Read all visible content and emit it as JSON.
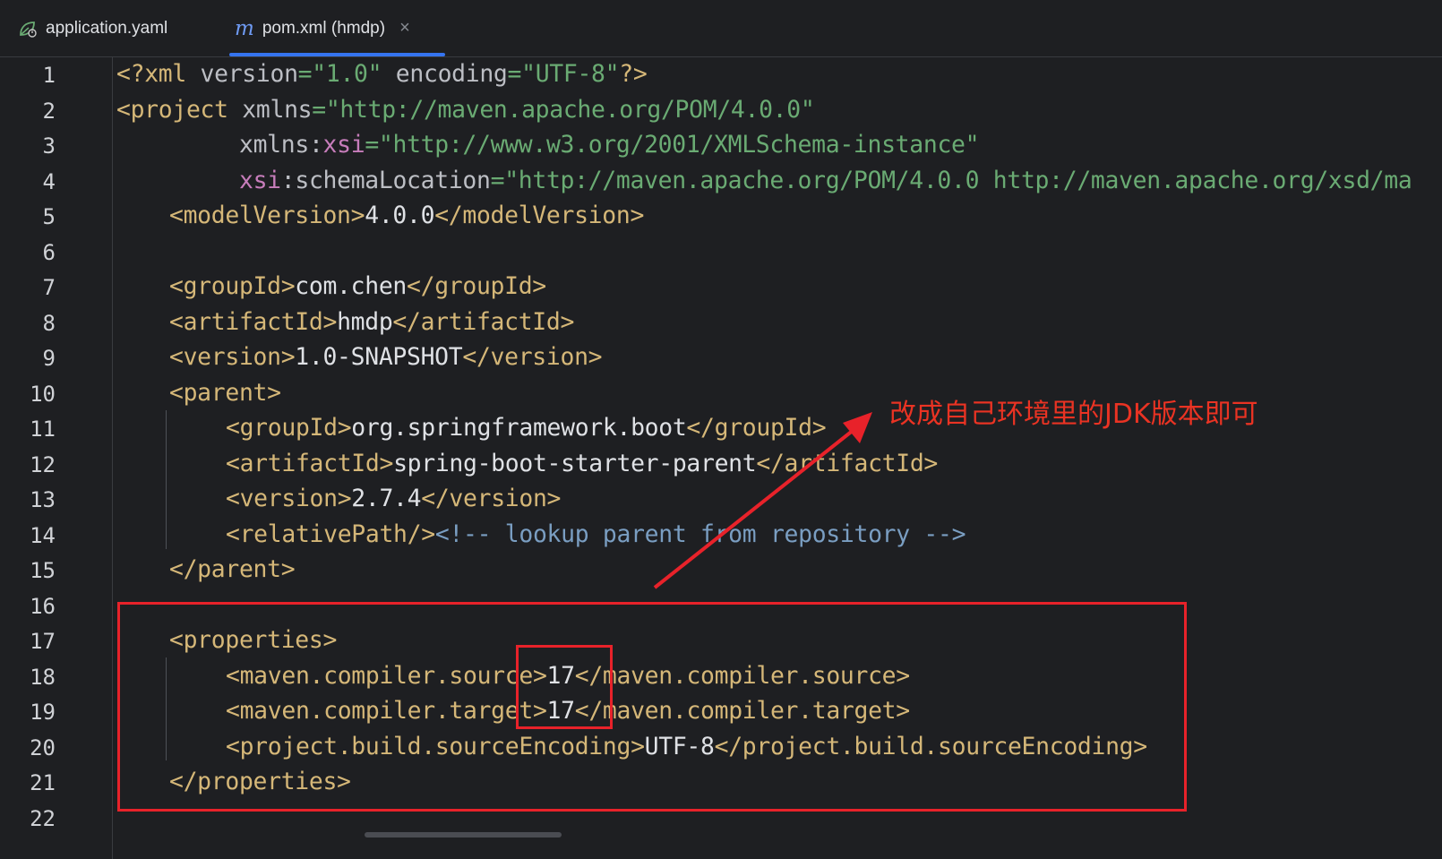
{
  "tabs": [
    {
      "label": "application.yaml",
      "icon": "spring-leaf-icon",
      "active": false
    },
    {
      "label": "pom.xml (hmdp)",
      "icon": "maven-m-icon",
      "icon_text": "m",
      "close": "×",
      "active": true
    }
  ],
  "line_numbers": [
    "1",
    "2",
    "3",
    "4",
    "5",
    "6",
    "7",
    "8",
    "9",
    "10",
    "11",
    "12",
    "13",
    "14",
    "15",
    "16",
    "17",
    "18",
    "19",
    "20",
    "21",
    "22"
  ],
  "code": {
    "l1": {
      "p1": "<?",
      "p2": "xml",
      "p3": " version",
      "p4": "=",
      "p5": "\"1.0\"",
      "p6": " encoding",
      "p7": "=",
      "p8": "\"UTF-8\"",
      "p9": "?>"
    },
    "l2": {
      "p1": "<project",
      "p2": " xmlns",
      "p3": "=",
      "p4": "\"http://maven.apache.org/POM/4.0.0\""
    },
    "l3": {
      "p1": "xmlns",
      "p2": ":",
      "p3": "xsi",
      "p4": "=",
      "p5": "\"http://www.w3.org/2001/XMLSchema-instance\""
    },
    "l4": {
      "p1": "xsi",
      "p2": ":schemaLocation",
      "p3": "=",
      "p4": "\"http://maven.apache.org/POM/4.0.0 http://maven.apache.org/xsd/ma"
    },
    "l5": {
      "o": "<modelVersion>",
      "t": "4.0.0",
      "c": "</modelVersion>"
    },
    "l7": {
      "o": "<groupId>",
      "t": "com.chen",
      "c": "</groupId>"
    },
    "l8": {
      "o": "<artifactId>",
      "t": "hmdp",
      "c": "</artifactId>"
    },
    "l9": {
      "o": "<version>",
      "t": "1.0-SNAPSHOT",
      "c": "</version>"
    },
    "l10": {
      "o": "<parent>"
    },
    "l11": {
      "o": "<groupId>",
      "t": "org.springframework.boot",
      "c": "</groupId>"
    },
    "l12": {
      "o": "<artifactId>",
      "t": "spring-boot-starter-parent",
      "c": "</artifactId>"
    },
    "l13": {
      "o": "<version>",
      "t": "2.7.4",
      "c": "</version>"
    },
    "l14": {
      "o": "<relativePath/>",
      "cm": "<!-- lookup parent from repository -->"
    },
    "l15": {
      "c": "</parent>"
    },
    "l17": {
      "o": "<properties>"
    },
    "l18": {
      "o": "<maven.compiler.source>",
      "t": "17",
      "c": "</maven.compiler.source>"
    },
    "l19": {
      "o": "<maven.compiler.target>",
      "t": "17",
      "c": "</maven.compiler.target>"
    },
    "l20": {
      "o": "<project.build.sourceEncoding>",
      "t": "UTF-8",
      "c": "</project.build.sourceEncoding>"
    },
    "l21": {
      "c": "</properties>"
    }
  },
  "annotation": {
    "text": "改成自己环境里的JDK版本即可",
    "color": "#ea3323"
  },
  "colors": {
    "background": "#1e1f22",
    "tag": "#d5b778",
    "attr_value": "#6aab73",
    "namespace": "#c77dbb",
    "comment": "#7a9ec2",
    "accent": "#3574f0",
    "highlight": "#e8222a"
  }
}
